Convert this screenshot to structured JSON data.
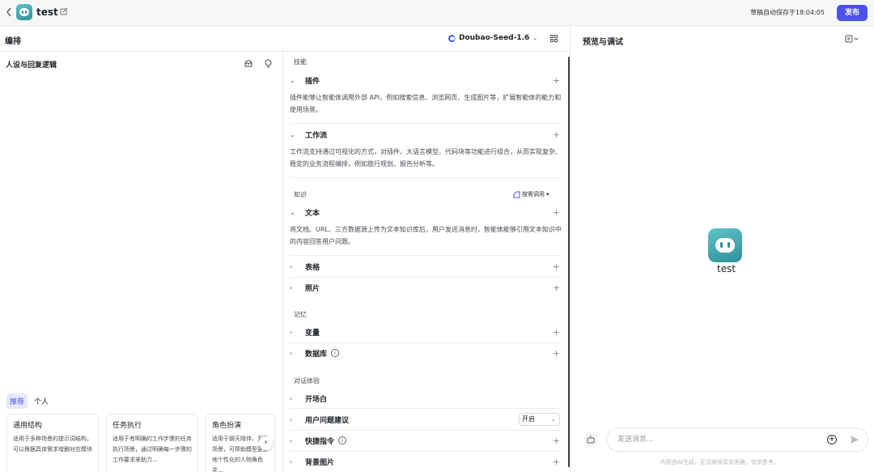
{
  "topbar": {
    "app_title": "test",
    "autosave": "草稿自动保存于18:04:05",
    "publish_label": "发布"
  },
  "editbar": {
    "title": "编排",
    "model": "Doubao-Seed-1.6"
  },
  "persona": {
    "title": "人设与回复逻辑",
    "tabs": [
      "推荐",
      "个人"
    ],
    "templates": [
      {
        "title": "通用结构",
        "desc": "适用于多种场景的提示词结构，可以根据具体需求增删对应模块"
      },
      {
        "title": "任务执行",
        "desc": "适用于有明确的工作步骤的任务执行场景，通过明确每一步骤的工作要求来助力..."
      },
      {
        "title": "角色扮演",
        "desc": "适用于聊天陪伴、互动场景，可帮助模型更好地个性化的人物角色并..."
      }
    ]
  },
  "skills": {
    "section": "技能",
    "plugin": {
      "label": "插件",
      "desc": "插件能够让智能体调用外部 API，例如搜索信息、浏览网页、生成图片等，扩展智能体的能力和使用场景。"
    },
    "workflow": {
      "label": "工作流",
      "desc": "工作流支持通过可视化的方式，对插件、大语言模型、代码块等功能进行组合，从而实现复杂、稳定的业务流程编排，例如旅行规划、报告分析等。"
    }
  },
  "knowledge": {
    "section": "知识",
    "on_demand": "按需调用",
    "text": {
      "label": "文本",
      "desc": "将文档、URL、三方数据源上传为文本知识库后，用户发送消息时，智能体能够引用文本知识中的内容回答用户问题。"
    },
    "table": "表格",
    "photo": "照片"
  },
  "memory": {
    "section": "记忆",
    "variables": "变量",
    "database": "数据库"
  },
  "dialog": {
    "section": "对话体验",
    "opening": "开场白",
    "suggestions": "用户问题建议",
    "suggestions_value": "开启",
    "shortcuts": "快捷指令",
    "background": "背景图片"
  },
  "preview": {
    "title": "预览与调试",
    "bot_name": "test",
    "input_placeholder": "发送消息...",
    "disclaimer": "内容由AI生成，无法确保真实准确，仅供参考。"
  }
}
